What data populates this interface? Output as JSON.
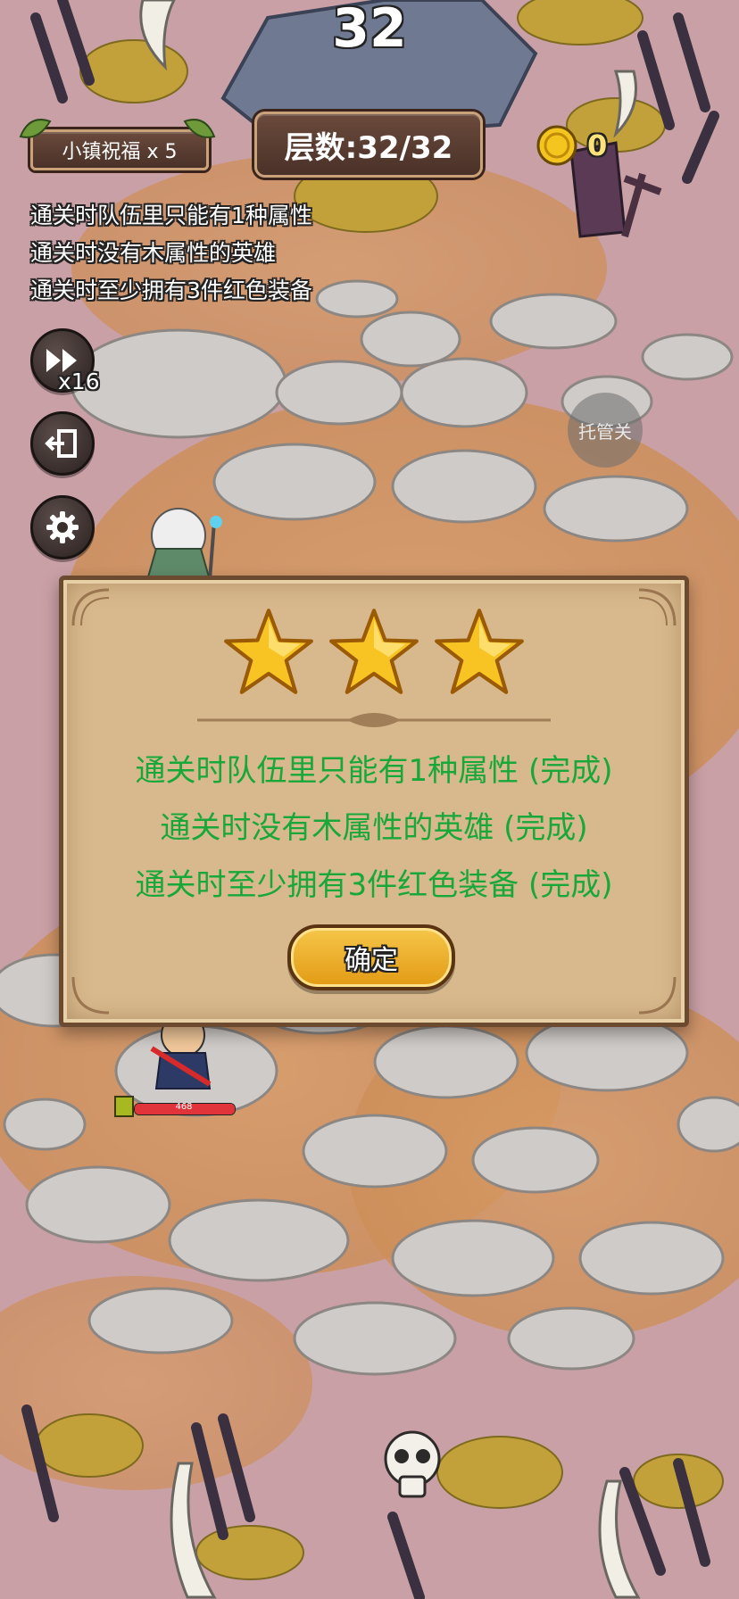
{
  "hud": {
    "level_badge": "32",
    "blessing_label": "小镇祝福 x 5",
    "floor_label": "层数:32/32",
    "coins": "0",
    "auto_label": "托管关"
  },
  "missions": [
    "通关时队伍里只能有1种属性",
    "通关时没有木属性的英雄",
    "通关时至少拥有3件红色装备"
  ],
  "controls": {
    "speed_multiplier": "x16"
  },
  "hero": {
    "hp": "468"
  },
  "result_dialog": {
    "stars_earned": 3,
    "goals": [
      "通关时队伍里只能有1种属性 (完成)",
      "通关时没有木属性的英雄 (完成)",
      "通关时至少拥有3件红色装备 (完成)"
    ],
    "confirm_label": "确定"
  },
  "colors": {
    "goal_complete": "#18a83a",
    "star": "#f7c423",
    "ground": "#c79aa0"
  }
}
